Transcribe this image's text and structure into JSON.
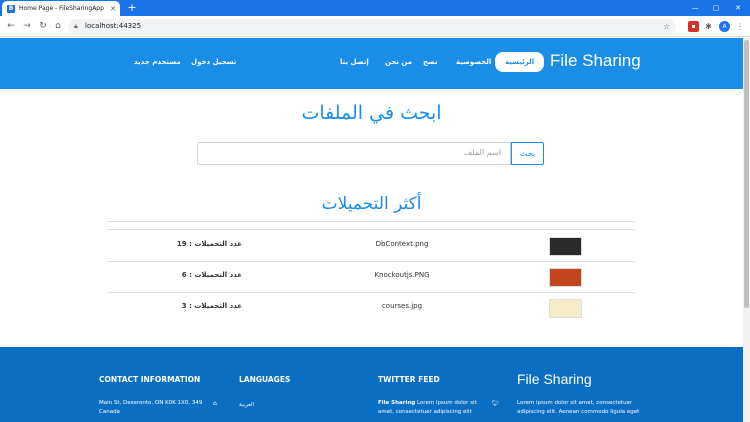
{
  "browser": {
    "tab_title": "Home Page - FileSharingApp",
    "tab_icon": "B",
    "new_tab": "+",
    "url": "localhost:44325",
    "profile_initial": "A",
    "minimize": "—",
    "maximize": "▢",
    "close": "✕"
  },
  "nav": {
    "brand": "File Sharing",
    "links": [
      "الرئيسية",
      "الخصوصية",
      "نصح",
      "من نحن",
      "إتصل بنا"
    ],
    "login": "تسجيل دخول",
    "register": "مستخدم جديد"
  },
  "search": {
    "title": "ابحث في الملفات",
    "placeholder": "اسم الملف",
    "button": "بحث"
  },
  "downloads": {
    "title": "أكثر التحميلات",
    "count_label": "عدد التحميلات",
    "rows": [
      {
        "file": "DbContext.png",
        "count": "عدد التحميلات : 19"
      },
      {
        "file": "Knockoutjs.PNG",
        "count": "عدد التحميلات : 6"
      },
      {
        "file": "courses.jpg",
        "count": "عدد التحميلات : 3"
      }
    ]
  },
  "footer": {
    "contact_head": "CONTACT INFORMATION",
    "contact_address": "Main St, Deseronto, ON K0K 1X0, 349",
    "contact_country": "Canada",
    "languages_head": "LANGUAGES",
    "language_1": "العربية",
    "twitter_head": "TWITTER FEED",
    "twitter_name": "File Sharing",
    "twitter_text_1": " Lorem ipsum dolor sit",
    "twitter_text_2": "amet, consectetuer adipiscing elit",
    "brand": "File Sharing",
    "about_1": "Lorem ipsum dolor sit amet, consectetuer",
    "about_2": "adipiscing elit. Aenean commodo ligula eget"
  }
}
